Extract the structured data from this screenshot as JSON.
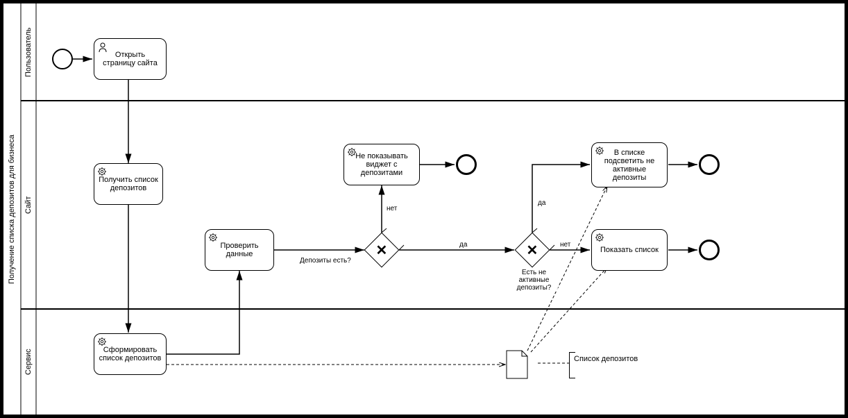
{
  "pool": {
    "name": "Получение списка депозитов для бизнеса"
  },
  "lanes": {
    "user": "Пользователь",
    "site": "Сайт",
    "service": "Сервис"
  },
  "tasks": {
    "open_page": "Открыть страницу сайта",
    "get_list": "Получить список депозитов",
    "check_data": "Проверить данные",
    "hide_widget": "Не показывать виджет с депозитами",
    "highlight_inactive": "В списке подсветить не активные депозиты",
    "show_list": "Показать список",
    "form_list": "Сформировать список депозитов"
  },
  "gateways": {
    "has_deposits": "Депозиты есть?",
    "has_inactive": "Есть не активные депозиты?"
  },
  "edges": {
    "no": "нет",
    "yes": "да"
  },
  "annotation": {
    "deposit_list": "Список депозитов"
  },
  "chart_data": {
    "type": "bpmn",
    "pool": "Получение списка депозитов для бизнеса",
    "lanes": [
      "Пользователь",
      "Сайт",
      "Сервис"
    ],
    "nodes": [
      {
        "id": "start",
        "type": "start-event",
        "lane": "Пользователь"
      },
      {
        "id": "open_page",
        "type": "user-task",
        "lane": "Пользователь",
        "label": "Открыть страницу сайта"
      },
      {
        "id": "get_list",
        "type": "service-task",
        "lane": "Сайт",
        "label": "Получить список депозитов"
      },
      {
        "id": "form_list",
        "type": "service-task",
        "lane": "Сервис",
        "label": "Сформировать список депозитов"
      },
      {
        "id": "check_data",
        "type": "service-task",
        "lane": "Сайт",
        "label": "Проверить данные"
      },
      {
        "id": "gw_deposits",
        "type": "exclusive-gateway",
        "lane": "Сайт",
        "label": "Депозиты есть?"
      },
      {
        "id": "hide_widget",
        "type": "service-task",
        "lane": "Сайт",
        "label": "Не показывать виджет с депозитами"
      },
      {
        "id": "end1",
        "type": "end-event",
        "lane": "Сайт"
      },
      {
        "id": "gw_inactive",
        "type": "exclusive-gateway",
        "lane": "Сайт",
        "label": "Есть не активные депозиты?"
      },
      {
        "id": "highlight",
        "type": "service-task",
        "lane": "Сайт",
        "label": "В списке подсветить не активные депозиты"
      },
      {
        "id": "show_list",
        "type": "service-task",
        "lane": "Сайт",
        "label": "Показать список"
      },
      {
        "id": "end2",
        "type": "end-event",
        "lane": "Сайт"
      },
      {
        "id": "end3",
        "type": "end-event",
        "lane": "Сайт"
      },
      {
        "id": "do_list",
        "type": "data-object",
        "lane": "Сервис",
        "label": "Список депозитов"
      }
    ],
    "flows": [
      {
        "from": "start",
        "to": "open_page",
        "type": "sequence"
      },
      {
        "from": "open_page",
        "to": "get_list",
        "type": "sequence"
      },
      {
        "from": "get_list",
        "to": "form_list",
        "type": "sequence"
      },
      {
        "from": "form_list",
        "to": "check_data",
        "type": "sequence"
      },
      {
        "from": "check_data",
        "to": "gw_deposits",
        "type": "sequence"
      },
      {
        "from": "gw_deposits",
        "to": "hide_widget",
        "type": "sequence",
        "label": "нет"
      },
      {
        "from": "hide_widget",
        "to": "end1",
        "type": "sequence"
      },
      {
        "from": "gw_deposits",
        "to": "gw_inactive",
        "type": "sequence",
        "label": "да"
      },
      {
        "from": "gw_inactive",
        "to": "highlight",
        "type": "sequence",
        "label": "да"
      },
      {
        "from": "gw_inactive",
        "to": "show_list",
        "type": "sequence",
        "label": "нет"
      },
      {
        "from": "highlight",
        "to": "end2",
        "type": "sequence"
      },
      {
        "from": "show_list",
        "to": "end3",
        "type": "sequence"
      },
      {
        "from": "form_list",
        "to": "do_list",
        "type": "data-association"
      },
      {
        "from": "do_list",
        "to": "highlight",
        "type": "data-association"
      },
      {
        "from": "do_list",
        "to": "show_list",
        "type": "data-association"
      }
    ]
  }
}
